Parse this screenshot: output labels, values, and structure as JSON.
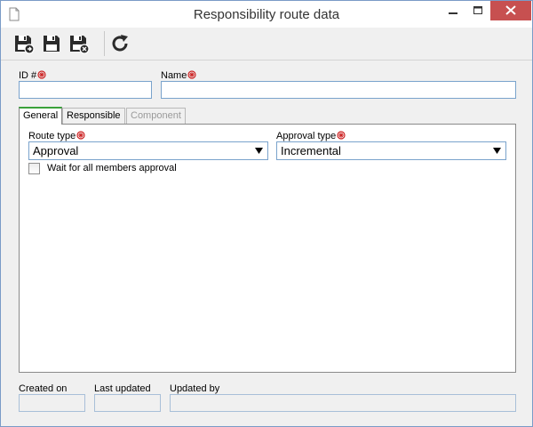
{
  "window": {
    "title": "Responsibility route data",
    "icons": {
      "document": "document-icon",
      "minimize": "minimize-icon",
      "maximize": "maximize-icon",
      "close": "close-icon"
    },
    "colors": {
      "close_bg": "#c75050",
      "accent_border": "#7aa3cc",
      "active_tab": "#3aa13a",
      "required": "#cc2222"
    }
  },
  "toolbar": {
    "buttons": [
      {
        "name": "save-and-new-button",
        "icon": "floppy-disk-new-icon"
      },
      {
        "name": "save-button",
        "icon": "floppy-disk-icon"
      },
      {
        "name": "save-and-close-button",
        "icon": "floppy-disk-close-icon"
      },
      {
        "name": "refresh-button",
        "icon": "refresh-icon"
      }
    ]
  },
  "form": {
    "id_label": "ID #",
    "id_value": "",
    "name_label": "Name",
    "name_value": ""
  },
  "tabs": [
    {
      "label": "General",
      "state": "active"
    },
    {
      "label": "Responsible",
      "state": "normal"
    },
    {
      "label": "Component",
      "state": "disabled"
    }
  ],
  "general": {
    "route_type_label": "Route type",
    "route_type_value": "Approval",
    "approval_type_label": "Approval type",
    "approval_type_value": "Incremental",
    "wait_label": "Wait for all members approval",
    "wait_checked": false
  },
  "footer": {
    "created_on_label": "Created on",
    "created_on_value": "",
    "last_updated_label": "Last updated",
    "last_updated_value": "",
    "updated_by_label": "Updated by",
    "updated_by_value": ""
  }
}
